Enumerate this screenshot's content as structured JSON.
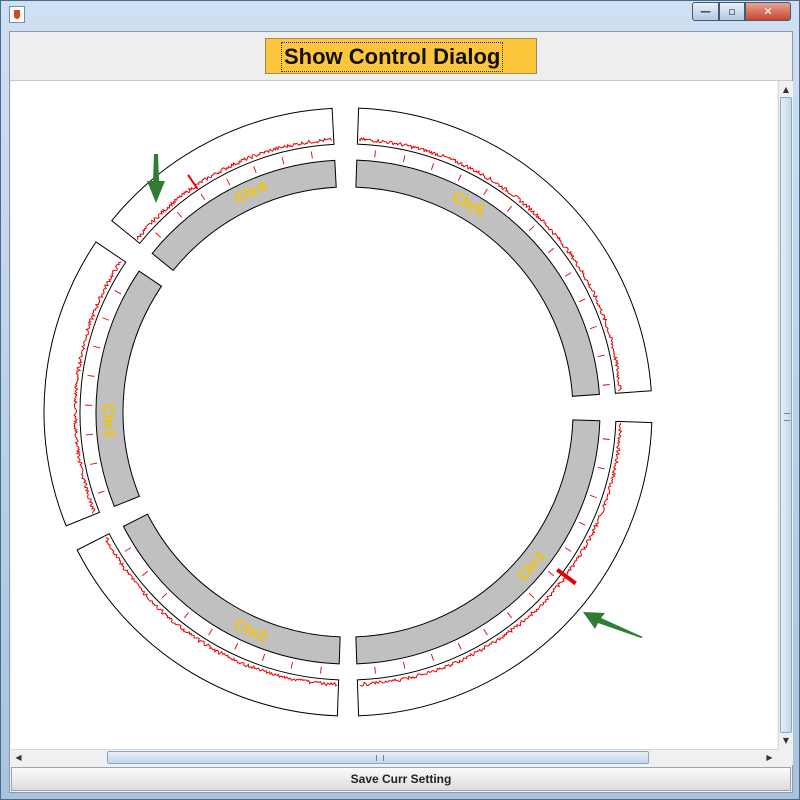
{
  "window": {
    "title": "",
    "controls": {
      "minimize": "—",
      "maximize": "▫",
      "close": "✕"
    },
    "icon": "java-cup-icon"
  },
  "toolbar": {
    "show_control_dialog": "Show Control Dialog"
  },
  "chromosomes": [
    {
      "name": "Chr1"
    },
    {
      "name": "Chr2"
    },
    {
      "name": "Chr3"
    },
    {
      "name": "Chr4"
    },
    {
      "name": "Chr5"
    }
  ],
  "colors": {
    "track_fill": "#c0c0c0",
    "signal": "#e60000",
    "label": "#f5c400",
    "arrow": "#2e7d32",
    "button_accent": "#fec63b"
  },
  "footer": {
    "save_label": "Save Curr Setting"
  }
}
